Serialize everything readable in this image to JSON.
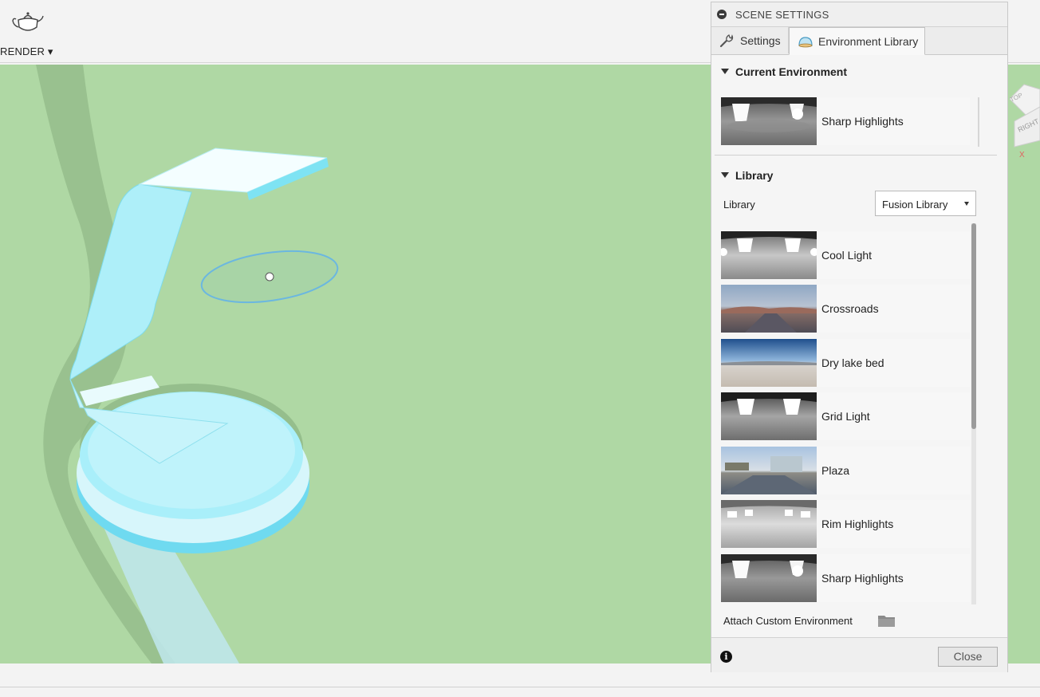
{
  "toolbar": {
    "render_label": "RENDER ▾",
    "render_icon": "teapot-icon"
  },
  "dialog": {
    "title": "SCENE SETTINGS",
    "tabs": [
      {
        "label": "Settings",
        "icon": "wrench-icon",
        "active": false
      },
      {
        "label": "Environment Library",
        "icon": "dome-icon",
        "active": true
      }
    ],
    "current_environment": {
      "heading": "Current Environment",
      "name": "Sharp Highlights"
    },
    "library": {
      "heading": "Library",
      "label": "Library",
      "selected": "Fusion Library",
      "items": [
        {
          "name": "Cool Light"
        },
        {
          "name": "Crossroads"
        },
        {
          "name": "Dry lake bed"
        },
        {
          "name": "Grid Light"
        },
        {
          "name": "Plaza"
        },
        {
          "name": "Rim Highlights"
        },
        {
          "name": "Sharp Highlights"
        }
      ]
    },
    "attach_label": "Attach Custom Environment",
    "close_label": "Close"
  },
  "viewcube": {
    "top_label": "TOP",
    "right_label": "RIGHT",
    "axis_label": "X"
  },
  "colors": {
    "viewport_bg": "#afd8a4",
    "model": "#8fe6f5"
  }
}
